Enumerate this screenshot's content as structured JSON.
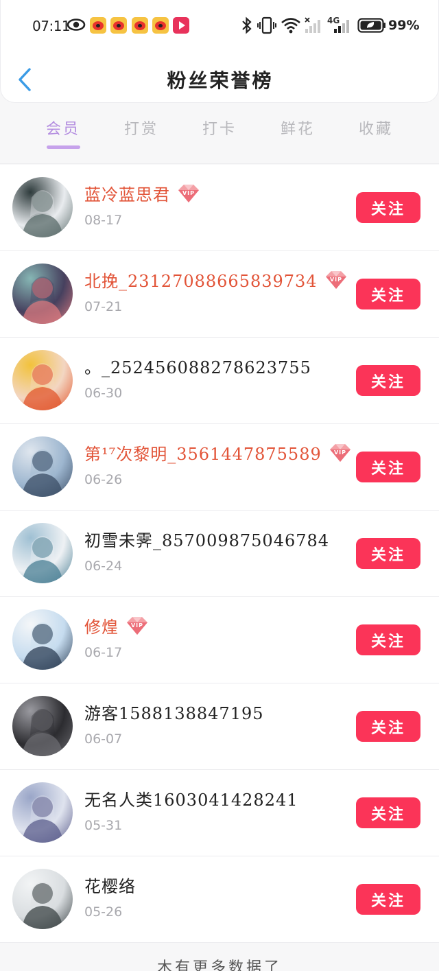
{
  "status_bar": {
    "time": "07:11",
    "battery": "99%",
    "network": "4G",
    "icons": [
      "eye-icon",
      "weibo-icon",
      "weibo-icon",
      "weibo-icon",
      "weibo-icon",
      "video-app-icon",
      "bluetooth-icon",
      "vibrate-icon",
      "wifi-icon",
      "signal-icon",
      "signal-4g-icon",
      "battery-icon"
    ]
  },
  "header": {
    "title": "粉丝荣誉榜",
    "back_icon": "chevron-left-icon"
  },
  "tabs": [
    {
      "label": "会员",
      "active": true
    },
    {
      "label": "打赏",
      "active": false
    },
    {
      "label": "打卡",
      "active": false
    },
    {
      "label": "鲜花",
      "active": false
    },
    {
      "label": "收藏",
      "active": false
    }
  ],
  "fans": [
    {
      "name": "蓝冷蓝思君",
      "date": "08-17",
      "vip": true,
      "follow_label": "关注",
      "avatar": "avatar-image"
    },
    {
      "name": "北挽_23127088665839734",
      "date": "07-21",
      "vip": true,
      "follow_label": "关注",
      "avatar": "avatar-image"
    },
    {
      "name": "。_252456088278623755",
      "date": "06-30",
      "vip": false,
      "follow_label": "关注",
      "avatar": "avatar-image"
    },
    {
      "name": "第¹⁷次黎明_3561447875589",
      "date": "06-26",
      "vip": true,
      "follow_label": "关注",
      "avatar": "avatar-image"
    },
    {
      "name": "初雪未霁_857009875046784",
      "date": "06-24",
      "vip": false,
      "follow_label": "关注",
      "avatar": "avatar-image"
    },
    {
      "name": "修煌",
      "date": "06-17",
      "vip": true,
      "follow_label": "关注",
      "avatar": "avatar-image"
    },
    {
      "name": "游客1588138847195",
      "date": "06-07",
      "vip": false,
      "follow_label": "关注",
      "avatar": "avatar-image"
    },
    {
      "name": "无名人类1603041428241",
      "date": "05-31",
      "vip": false,
      "follow_label": "关注",
      "avatar": "avatar-image"
    },
    {
      "name": "花樱络",
      "date": "05-26",
      "vip": false,
      "follow_label": "关注",
      "avatar": "avatar-image"
    }
  ],
  "footer": {
    "text": "木有更多数据了"
  },
  "colors": {
    "accent_tab": "#b48ee0",
    "vip_name": "#e25438",
    "follow_button": "#fb3458",
    "back_arrow": "#3a9be6"
  }
}
